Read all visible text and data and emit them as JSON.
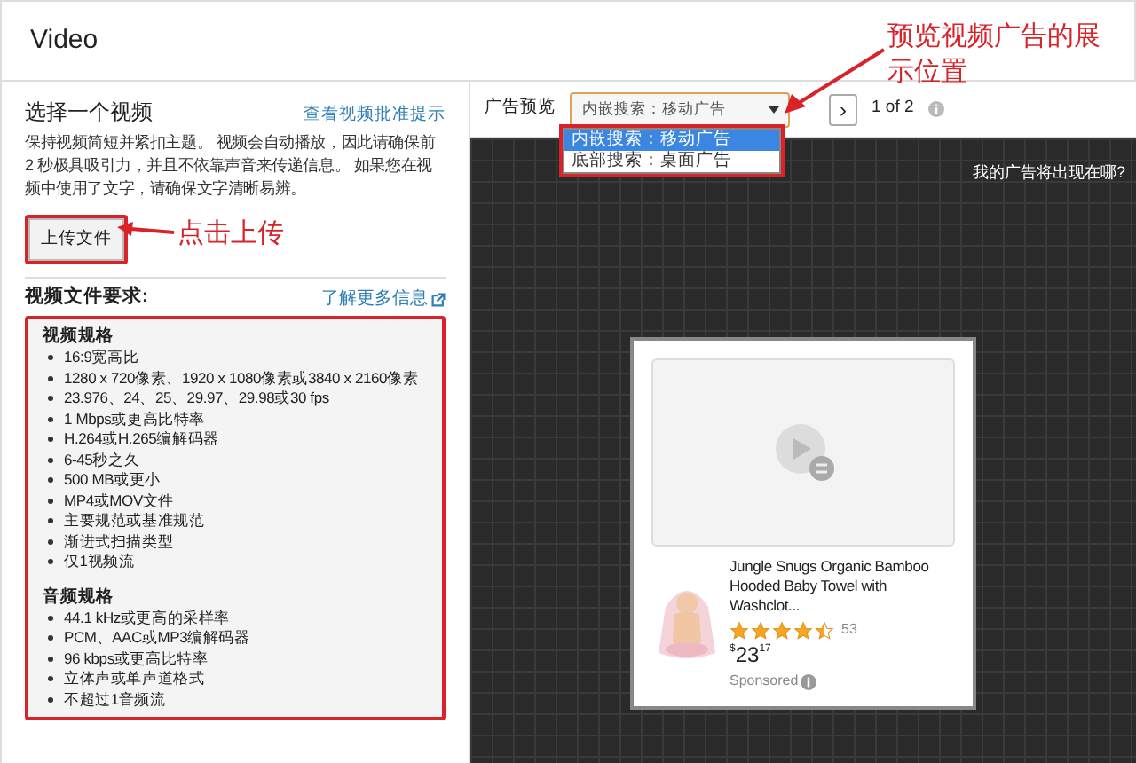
{
  "header": {
    "title": "Video"
  },
  "left": {
    "title": "选择一个视频",
    "guide_link": "查看视频批准提示",
    "description": "保持视频简短并紧扣主题。 视频会自动播放，因此请确保前 2 秒极具吸引力，并且不依靠声音来传递信息。 如果您在视频中使用了文字，请确保文字清晰易辨。",
    "upload_button": "上传文件",
    "requirements_title": "视频文件要求:",
    "more_link": "了解更多信息",
    "sections": [
      {
        "title": "视频规格",
        "items": [
          "16:9宽高比",
          "1280 x 720像素、1920 x 1080像素或3840 x 2160像素",
          "23.976、24、25、29.97、29.98或30 fps",
          "1 Mbps或更高比特率",
          "H.264或H.265编解码器",
          "6-45秒之久",
          "500 MB或更小",
          "MP4或MOV文件",
          "主要规范或基准规范",
          "渐进式扫描类型",
          "仅1视频流"
        ]
      },
      {
        "title": "音频规格",
        "items": [
          "44.1 kHz或更高的采样率",
          "PCM、AAC或MP3编解码器",
          "96 kbps或更高比特率",
          "立体声或单声道格式",
          "不超过1音频流"
        ]
      }
    ]
  },
  "preview": {
    "label": "广告预览",
    "select_value": "内嵌搜索：移动广告",
    "options": [
      {
        "label": "内嵌搜索：移动广告",
        "selected": true
      },
      {
        "label": "底部搜索：桌面广告",
        "selected": false
      }
    ],
    "next": "›",
    "pager": "1 of 2",
    "help_link": "我的广告将出现在哪?",
    "ad": {
      "title": "Jungle Snugs Organic Bamboo Hooded Baby Towel with Washclot...",
      "stars": 4.5,
      "reviews": "53",
      "currency": "$",
      "price_whole": "23",
      "price_fraction": "17",
      "sponsored": "Sponsored"
    }
  },
  "annotations": [
    {
      "text": "点击上传"
    },
    {
      "text": "预览视频广告的展示位置"
    }
  ]
}
